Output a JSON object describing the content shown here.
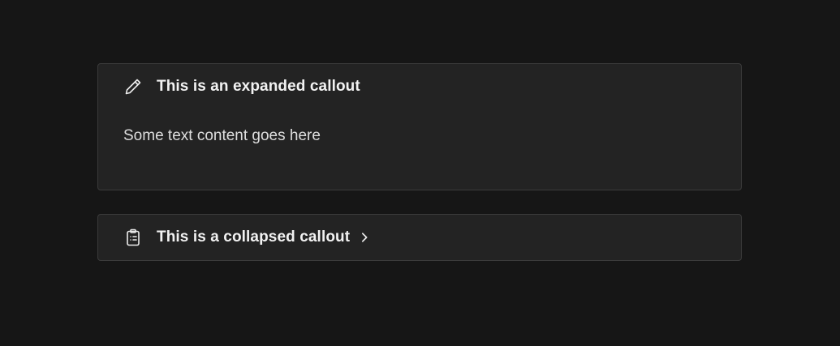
{
  "callouts": {
    "expanded": {
      "icon": "pencil-icon",
      "title": "This is an expanded callout",
      "body": "Some text content goes here"
    },
    "collapsed": {
      "icon": "clipboard-list-icon",
      "title": "This is a collapsed callout",
      "toggle_icon": "chevron-right-icon"
    }
  },
  "colors": {
    "background": "#161616",
    "callout_background": "#232323",
    "callout_border": "#3b3b3b",
    "text": "#f2f2f2"
  }
}
